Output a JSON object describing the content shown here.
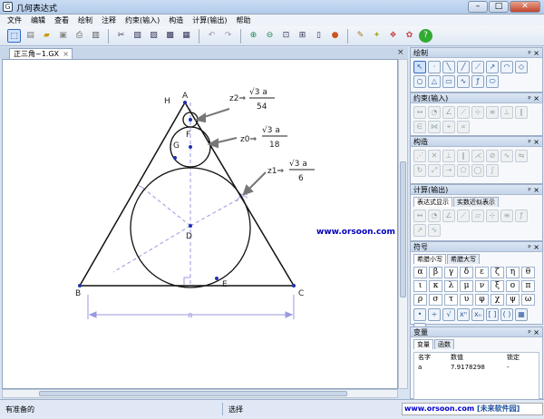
{
  "window": {
    "title": "几何表达式"
  },
  "menu": [
    "文件",
    "编辑",
    "查看",
    "绘制",
    "注释",
    "约束(输入)",
    "构造",
    "计算(输出)",
    "帮助"
  ],
  "document": {
    "tab_label": "正三角~1.GX",
    "close_glyph": "×"
  },
  "figure": {
    "points": [
      "A",
      "B",
      "C",
      "D",
      "E",
      "F",
      "G",
      "H"
    ],
    "length_label": "a",
    "z2_label": "z2⇒",
    "z2_num": "√3 a",
    "z2_den": "54",
    "z0_label": "z0⇒",
    "z0_num": "√3 a",
    "z0_den": "18",
    "z1_label": "z1⇒",
    "z1_num": "√3 a",
    "z1_den": "6"
  },
  "panels": {
    "draw": "绘制",
    "constraint": "约束(输入)",
    "construct": "构造",
    "compute": "计算(输出)",
    "compute_tabs": [
      "表达式显示",
      "实数近似表示"
    ],
    "symbols": "符号",
    "symbol_tabs": [
      "希腊小写",
      "希腊大写"
    ],
    "greek": [
      "α",
      "β",
      "γ",
      "δ",
      "ε",
      "ζ",
      "η",
      "θ",
      "ι",
      "κ",
      "λ",
      "μ",
      "ν",
      "ξ",
      "ο",
      "π",
      "ρ",
      "σ",
      "τ",
      "υ",
      "φ",
      "χ",
      "ψ",
      "ω"
    ],
    "vars": "变量",
    "vars_tabs": [
      "变量",
      "函数"
    ],
    "var_headers": [
      "名字",
      "数值",
      "锁定"
    ],
    "var_row": [
      "a",
      "7.9178298",
      "-"
    ]
  },
  "status": {
    "left": "有准备的",
    "right": "选择"
  },
  "watermark": {
    "site": "www.orsoon.com",
    "brand": "[未来软件园]"
  },
  "overlay_site": "www.orsoon.com",
  "pin_glyphs": "ᵖ ×"
}
